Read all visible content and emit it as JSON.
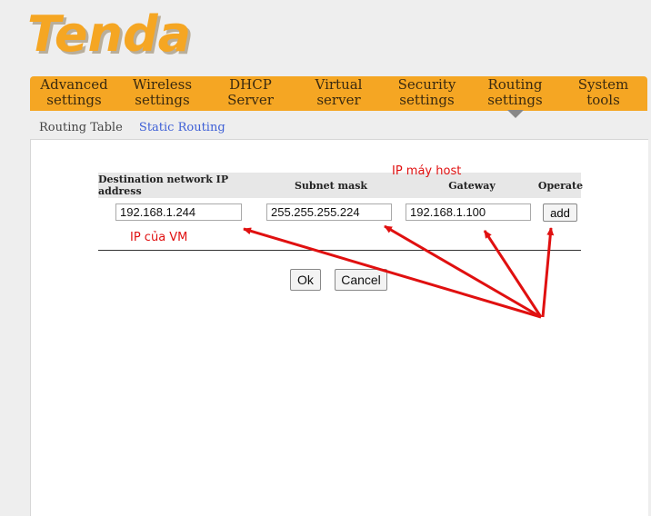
{
  "logo": {
    "text": "Tenda",
    "color": "#f5a623"
  },
  "nav": {
    "items": [
      {
        "line1": "Advanced",
        "line2": "settings"
      },
      {
        "line1": "Wireless",
        "line2": "settings"
      },
      {
        "line1": "DHCP",
        "line2": "Server"
      },
      {
        "line1": "Virtual",
        "line2": "server"
      },
      {
        "line1": "Security",
        "line2": "settings"
      },
      {
        "line1": "Routing",
        "line2": "settings"
      },
      {
        "line1": "System",
        "line2": "tools"
      }
    ],
    "active": "Routing settings"
  },
  "subnav": {
    "routing_table": "Routing Table",
    "static_routing": "Static Routing",
    "active": "Static Routing"
  },
  "table": {
    "headers": {
      "destination": "Destination network IP address",
      "subnet": "Subnet mask",
      "gateway": "Gateway",
      "operate": "Operate"
    },
    "row": {
      "destination": "192.168.1.244",
      "subnet": "255.255.255.224",
      "gateway": "192.168.1.100",
      "add_label": "add"
    }
  },
  "buttons": {
    "ok": "Ok",
    "cancel": "Cancel"
  },
  "annotations": {
    "ip_host": "IP máy host",
    "ip_vm": "IP của VM",
    "color": "#e01010"
  }
}
